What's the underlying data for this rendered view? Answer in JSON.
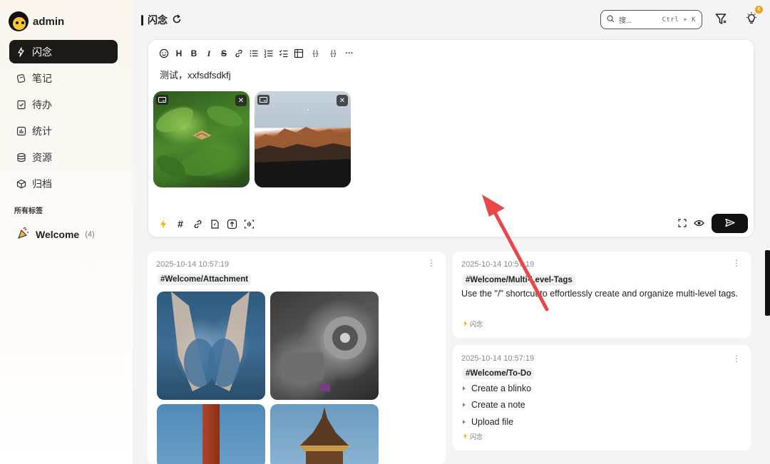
{
  "user": {
    "name": "admin"
  },
  "sidebar": {
    "items": [
      {
        "label": "闪念",
        "icon": "flash-icon",
        "active": true
      },
      {
        "label": "笔记",
        "icon": "note-icon"
      },
      {
        "label": "待办",
        "icon": "todo-icon"
      },
      {
        "label": "统计",
        "icon": "chart-icon"
      },
      {
        "label": "资源",
        "icon": "database-icon"
      },
      {
        "label": "归档",
        "icon": "archive-box-icon"
      }
    ],
    "tags_title": "所有标签",
    "tags": [
      {
        "name": "Welcome",
        "count": "(4)"
      }
    ]
  },
  "header": {
    "title": "闪念",
    "search": {
      "placeholder": "搜...",
      "shortcut": "Ctrl + K"
    },
    "notification_count": "6"
  },
  "editor": {
    "content": "测试，xxfsdfsdkfj",
    "toolbar": [
      "emoji",
      "heading",
      "bold",
      "italic",
      "strikethrough",
      "link",
      "bullet-list",
      "ordered-list",
      "check-list",
      "table",
      "code-inline",
      "code-block",
      "more"
    ],
    "toolbar_glyphs": {
      "heading": "H",
      "bold": "B",
      "italic": "I",
      "strikethrough": "S",
      "code_inline": "{-}",
      "code_block": "{-}",
      "more": "···"
    },
    "attachments": [
      "leaf-butterfly-image",
      "mountain-image"
    ],
    "send_icon": "send-icon"
  },
  "cards": [
    {
      "time": "2025-10-14 10:57:19",
      "tag": "#Welcome/Attachment"
    },
    {
      "time": "2025-10-14 10:57:19",
      "tag": "#Welcome/Multi-Level-Tags",
      "body": "Use the \"/\" shortcut to effortlessly create and organize multi-level tags.",
      "type_label": "闪念"
    },
    {
      "time": "2025-10-14 10:57:19",
      "tag": "#Welcome/To-Do",
      "todos": [
        "Create a blinko",
        "Create a note",
        "Upload file"
      ],
      "type_label": "闪念"
    }
  ],
  "colors": {
    "accent": "#1c1a16",
    "badge": "#f0a020",
    "annotation_arrow": "#e8484a",
    "flash": "#f0b400"
  }
}
